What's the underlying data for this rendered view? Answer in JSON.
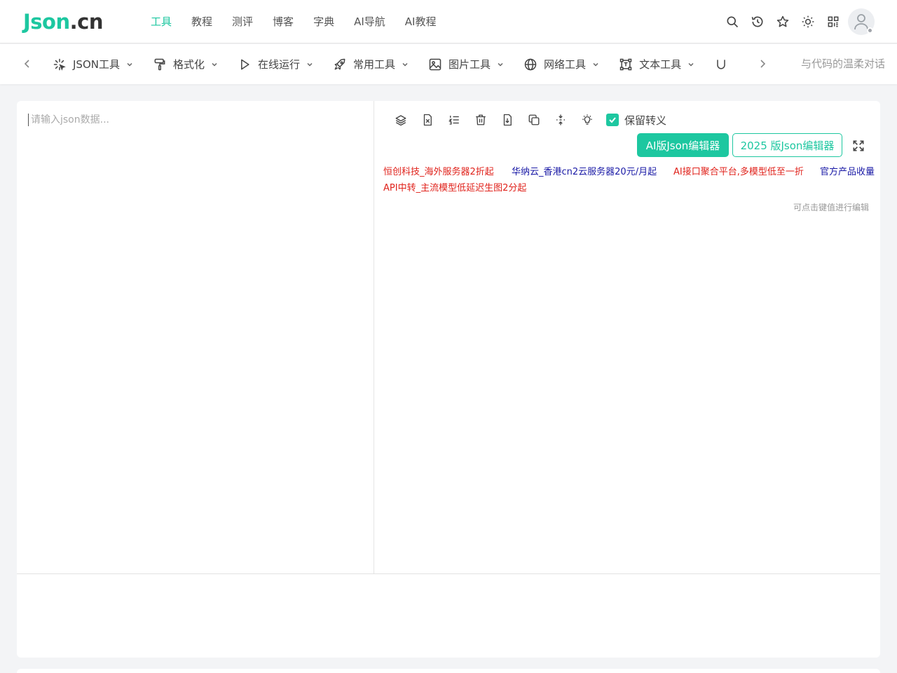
{
  "header": {
    "logo_main": "Json",
    "logo_suffix": ".cn",
    "nav": [
      {
        "label": "工具",
        "active": true
      },
      {
        "label": "教程",
        "active": false
      },
      {
        "label": "测评",
        "active": false
      },
      {
        "label": "博客",
        "active": false
      },
      {
        "label": "字典",
        "active": false
      },
      {
        "label": "AI导航",
        "active": false
      },
      {
        "label": "AI教程",
        "active": false
      }
    ],
    "icons": [
      "search-icon",
      "history-icon",
      "star-icon",
      "sun-icon",
      "qr-code-icon"
    ]
  },
  "toolbar_nav": {
    "items": [
      {
        "label": "JSON工具",
        "icon": "sparkle-icon"
      },
      {
        "label": "格式化",
        "icon": "paint-roller-icon"
      },
      {
        "label": "在线运行",
        "icon": "play-icon"
      },
      {
        "label": "常用工具",
        "icon": "rocket-icon"
      },
      {
        "label": "图片工具",
        "icon": "image-icon"
      },
      {
        "label": "网络工具",
        "icon": "globe-icon"
      },
      {
        "label": "文本工具",
        "icon": "text-frame-icon"
      }
    ],
    "slogan": "与代码的温柔对话"
  },
  "editor": {
    "placeholder": "请输入json数据...",
    "keep_escape_label": "保留转义",
    "keep_escape_checked": true,
    "ai_button": "AI版Json编辑器",
    "v2025_button": "2025 版Json编辑器",
    "hint": "可点击键值进行编辑"
  },
  "ads": [
    {
      "text": "恒创科技_海外服务器2折起",
      "color": "#e0221b"
    },
    {
      "text": "华纳云_香港cn2云服务器20元/月起",
      "color": "#1a1aa6"
    },
    {
      "text": "AI接口聚合平台,多模型低至一折",
      "color": "#e0221b"
    },
    {
      "text": "官方产品收量",
      "color": "#1a1aa6"
    },
    {
      "text": "API中转_主流模型低延迟生图2分起",
      "color": "#e0221b"
    }
  ],
  "colors": {
    "accent": "#1dc7a0"
  }
}
